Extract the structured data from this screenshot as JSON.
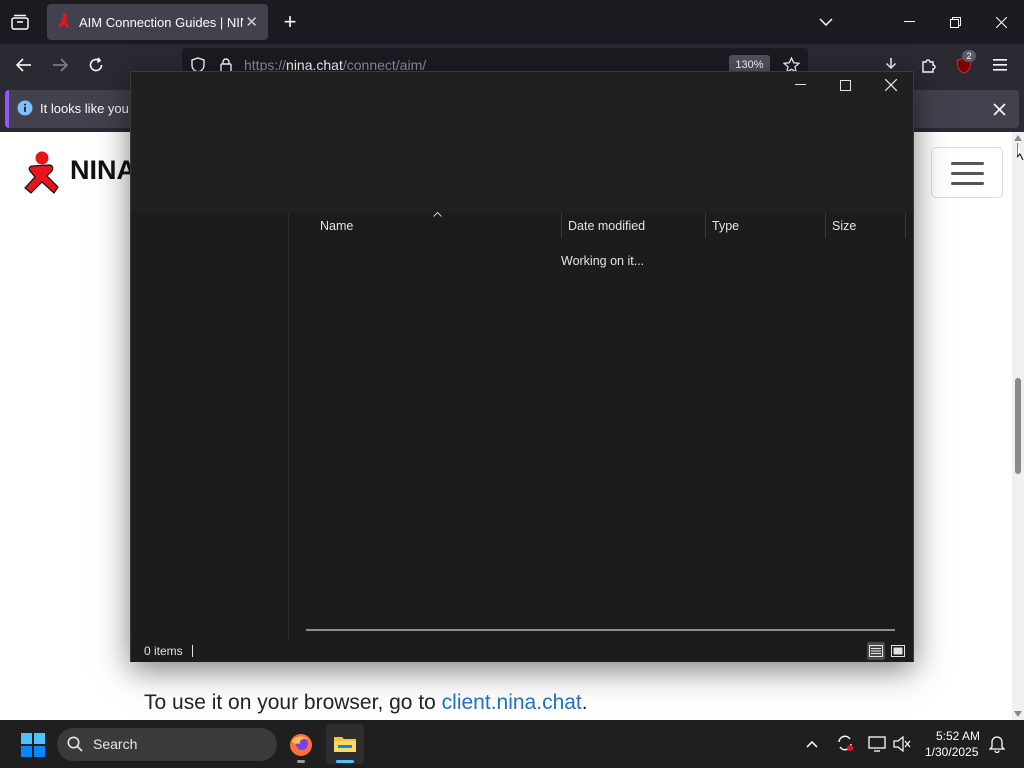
{
  "browser": {
    "tab": {
      "title": "AIM Connection Guides | NINA"
    },
    "url": {
      "prefix": "https://",
      "host": "nina.chat",
      "path": "/connect/aim/"
    },
    "zoom": "130%",
    "extensions_badge": "2",
    "notification": {
      "text": "It looks like you h"
    }
  },
  "page": {
    "brand": "NINA",
    "footer_line": {
      "text": "To use it on your browser, go to ",
      "link": "client.nina.chat",
      "suffix": "."
    }
  },
  "dialog": {
    "columns": [
      {
        "label": "Name"
      },
      {
        "label": "Date modified"
      },
      {
        "label": "Type"
      },
      {
        "label": "Size"
      }
    ],
    "placeholder": "Working on it...",
    "status": "0 items"
  },
  "taskbar": {
    "search_label": "Search",
    "time": "5:52 AM",
    "date": "1/30/2025"
  },
  "colors": {
    "browser_accent": "#9059ff",
    "aim_red": "#e8141c",
    "link_blue": "#1e73be",
    "windows_blue": "#0a84ff"
  }
}
